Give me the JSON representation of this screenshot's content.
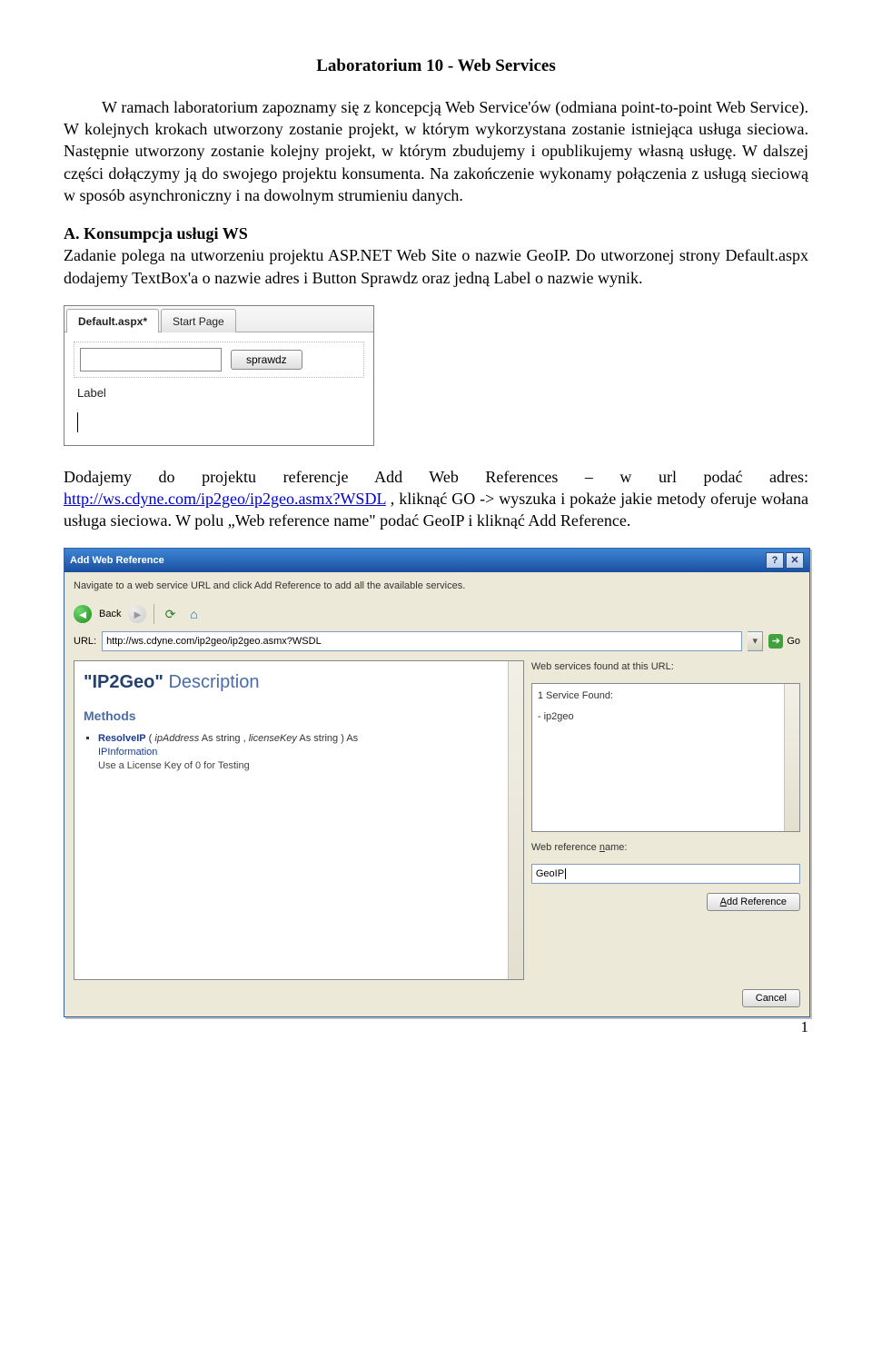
{
  "title": "Laboratorium 10 - Web Services",
  "para1": "W ramach laboratorium zapoznamy się z koncepcją Web Service'ów (odmiana point-to-point Web Service). W kolejnych krokach utworzony zostanie projekt, w którym wykorzystana zostanie istniejąca usługa sieciowa. Następnie utworzony zostanie kolejny projekt, w którym zbudujemy i opublikujemy własną usługę. W dalszej części dołączymy ją do swojego projektu konsumenta. Na zakończenie wykonamy połączenia z usługą sieciową w sposób asynchroniczny i na dowolnym strumieniu danych.",
  "sectionA_head": "A. Konsumpcja usługi WS",
  "sectionA_body": "Zadanie polega na utworzeniu projektu ASP.NET Web Site o nazwie GeoIP. Do utworzonej strony Default.aspx dodajemy TextBox'a o nazwie adres i Button Sprawdz oraz jedną Label o nazwie wynik.",
  "shot1": {
    "tab_active": "Default.aspx*",
    "tab_other": "Start Page",
    "button_label": "sprawdz",
    "label_text": "Label"
  },
  "para2_pre": "Dodajemy do projektu referencje Add Web References – w url podać adres: ",
  "para2_link": "http://ws.cdyne.com/ip2geo/ip2geo.asmx?WSDL",
  "para2_post": " , kliknąć GO -> wyszuka i pokaże jakie metody oferuje wołana usługa sieciowa. W polu „Web reference name\" podać  GeoIP i kliknąć Add Reference.",
  "dlg": {
    "title": "Add Web Reference",
    "instr": "Navigate to a web service URL and click Add Reference to add all the available services.",
    "back": "Back",
    "url_label": "URL:",
    "url_value": "http://ws.cdyne.com/ip2geo/ip2geo.asmx?WSDL",
    "go": "Go",
    "ws_title_plain": "\"IP2Geo\" ",
    "ws_title_light": "Description",
    "ws_methods": "Methods",
    "method_name": "ResolveIP",
    "method_sig_open": " ( ",
    "method_p1": "ipAddress",
    "method_p1t": " As string",
    "method_sep": " ,  ",
    "method_p2": "licenseKey",
    "method_p2t": " As string",
    "method_sig_close": " ) As",
    "method_ret": "IPInformation",
    "method_desc": "Use a License Key of 0 for Testing",
    "found_label": "Web services found at this URL:",
    "found_1": "1 Service Found:",
    "found_2": "- ip2geo",
    "refname_label": "Web reference name:",
    "refname_value": "GeoIP",
    "refname_key": "n",
    "add_btn": "Add Reference",
    "cancel_btn": "Cancel"
  },
  "page_number": "1"
}
